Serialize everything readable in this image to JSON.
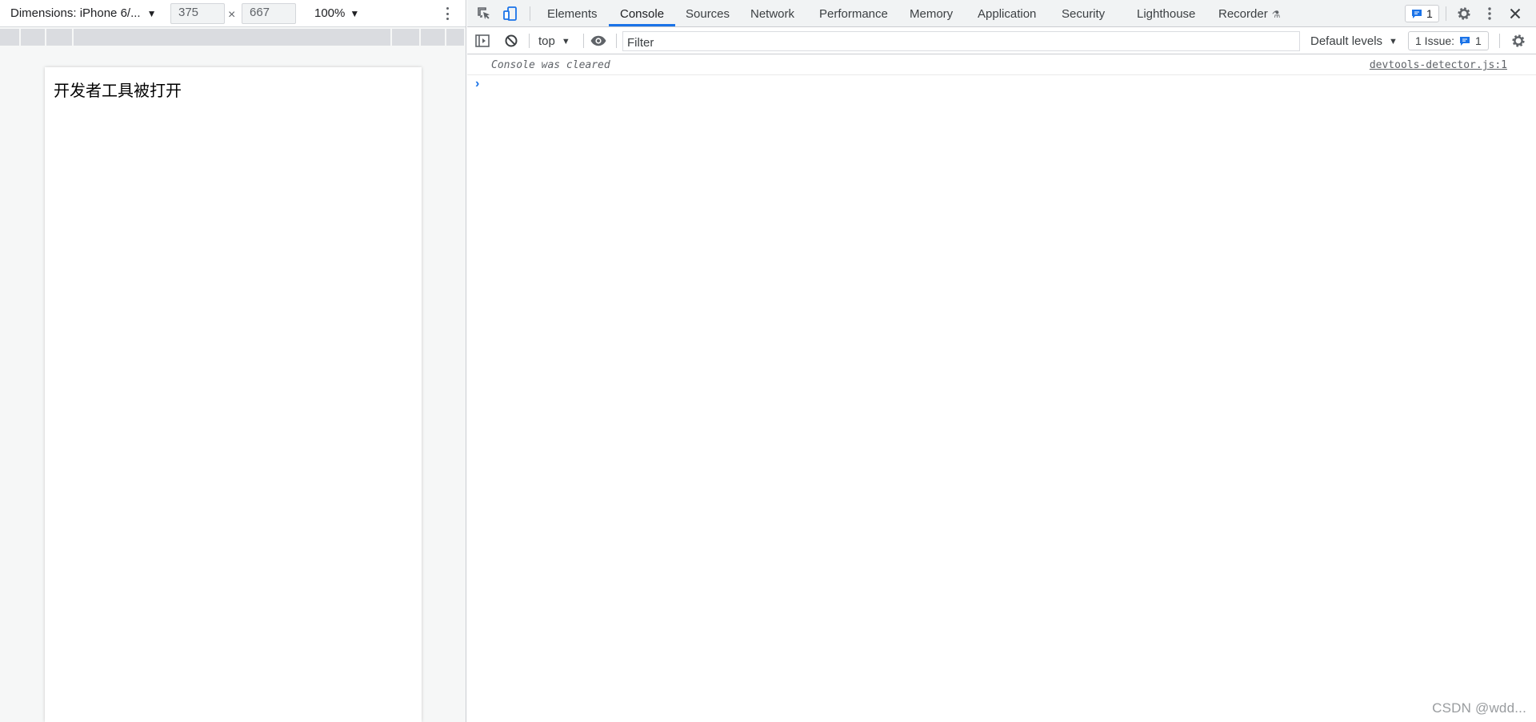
{
  "device_toolbar": {
    "dimensions_label": "Dimensions: iPhone 6/...",
    "width_value": "375",
    "times": "×",
    "height_value": "667",
    "zoom_label": "100%"
  },
  "device_page": {
    "heading": "开发者工具被打开"
  },
  "tabs": [
    {
      "label": "Elements"
    },
    {
      "label": "Console"
    },
    {
      "label": "Sources"
    },
    {
      "label": "Network"
    },
    {
      "label": "Performance"
    },
    {
      "label": "Memory"
    },
    {
      "label": "Application"
    },
    {
      "label": "Security"
    },
    {
      "label": "Lighthouse"
    },
    {
      "label": "Recorder"
    }
  ],
  "active_tab": "Console",
  "message_count": "1",
  "console_toolbar": {
    "context": "top",
    "filter_placeholder": "Filter",
    "levels": "Default levels",
    "issues_label": "1 Issue:",
    "issues_count": "1"
  },
  "console": {
    "message": "Console was cleared",
    "source": "devtools-detector.js:1"
  },
  "watermark": "CSDN @wdd...",
  "colors": {
    "accent": "#1a73e8",
    "toolbar_bg": "#f1f3f4",
    "device_bg": "#f6f7f7"
  },
  "icons": [
    "inspect-element-icon",
    "device-toggle-icon",
    "recorder-flask-icon",
    "message-icon",
    "settings-gear-icon",
    "more-kebab-icon",
    "close-icon",
    "sidebar-toggle-icon",
    "clear-console-icon",
    "eye-icon",
    "chevron-prompt-icon"
  ]
}
